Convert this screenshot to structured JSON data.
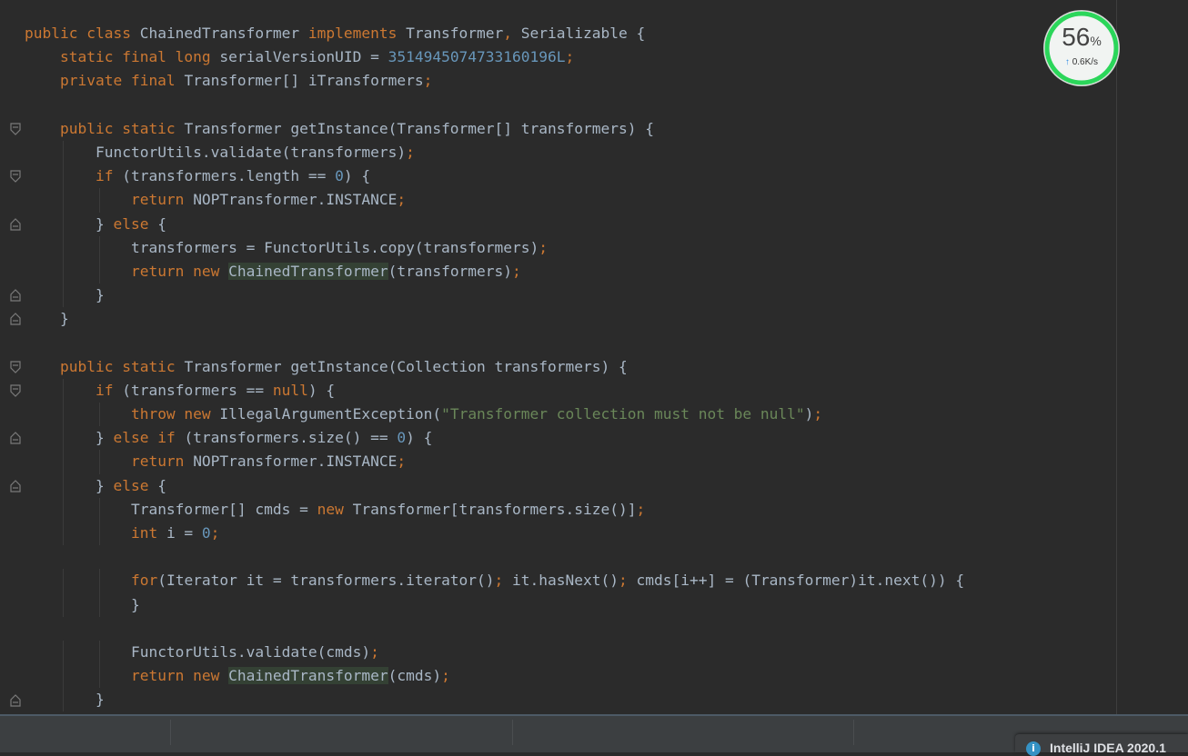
{
  "code_lines": [
    [
      {
        "t": "public class ",
        "c": "kw"
      },
      {
        "t": "ChainedTransformer "
      },
      {
        "t": "implements ",
        "c": "kw"
      },
      {
        "t": "Transformer"
      },
      {
        "t": ", ",
        "c": "kw"
      },
      {
        "t": "Serializable {"
      }
    ],
    [
      {
        "t": "    "
      },
      {
        "t": "static final long ",
        "c": "kw"
      },
      {
        "t": "serialVersionUID = "
      },
      {
        "t": "3514945074733160196L",
        "c": "num"
      },
      {
        "t": ";",
        "c": "kw"
      }
    ],
    [
      {
        "t": "    "
      },
      {
        "t": "private final ",
        "c": "kw"
      },
      {
        "t": "Transformer[] iTransformers"
      },
      {
        "t": ";",
        "c": "kw"
      }
    ],
    [],
    [
      {
        "t": "    "
      },
      {
        "t": "public static ",
        "c": "kw"
      },
      {
        "t": "Transformer getInstance(Transformer[] transformers) {"
      }
    ],
    [
      {
        "t": "        "
      },
      {
        "t": "FunctorUtils.validate(transformers)"
      },
      {
        "t": ";",
        "c": "kw"
      }
    ],
    [
      {
        "t": "        "
      },
      {
        "t": "if ",
        "c": "kw"
      },
      {
        "t": "(transformers.length == "
      },
      {
        "t": "0",
        "c": "num"
      },
      {
        "t": ") {"
      }
    ],
    [
      {
        "t": "            "
      },
      {
        "t": "return ",
        "c": "kw"
      },
      {
        "t": "NOPTransformer.INSTANCE"
      },
      {
        "t": ";",
        "c": "kw"
      }
    ],
    [
      {
        "t": "        "
      },
      {
        "t": "} "
      },
      {
        "t": "else ",
        "c": "kw"
      },
      {
        "t": "{"
      }
    ],
    [
      {
        "t": "            "
      },
      {
        "t": "transformers = FunctorUtils.copy(transformers)"
      },
      {
        "t": ";",
        "c": "kw"
      }
    ],
    [
      {
        "t": "            "
      },
      {
        "t": "return new ",
        "c": "kw"
      },
      {
        "t": "ChainedTransformer",
        "c": "hl"
      },
      {
        "t": "(transformers)"
      },
      {
        "t": ";",
        "c": "kw"
      }
    ],
    [
      {
        "t": "        "
      },
      {
        "t": "}"
      }
    ],
    [
      {
        "t": "    "
      },
      {
        "t": "}"
      }
    ],
    [],
    [
      {
        "t": "    "
      },
      {
        "t": "public static ",
        "c": "kw"
      },
      {
        "t": "Transformer getInstance(Collection transformers) {"
      }
    ],
    [
      {
        "t": "        "
      },
      {
        "t": "if ",
        "c": "kw"
      },
      {
        "t": "(transformers == "
      },
      {
        "t": "null",
        "c": "kw"
      },
      {
        "t": ") {"
      }
    ],
    [
      {
        "t": "            "
      },
      {
        "t": "throw new ",
        "c": "kw"
      },
      {
        "t": "IllegalArgumentException("
      },
      {
        "t": "\"Transformer collection must not be null\"",
        "c": "str"
      },
      {
        "t": ")"
      },
      {
        "t": ";",
        "c": "kw"
      }
    ],
    [
      {
        "t": "        "
      },
      {
        "t": "} "
      },
      {
        "t": "else if ",
        "c": "kw"
      },
      {
        "t": "(transformers.size() == "
      },
      {
        "t": "0",
        "c": "num"
      },
      {
        "t": ") {"
      }
    ],
    [
      {
        "t": "            "
      },
      {
        "t": "return ",
        "c": "kw"
      },
      {
        "t": "NOPTransformer.INSTANCE"
      },
      {
        "t": ";",
        "c": "kw"
      }
    ],
    [
      {
        "t": "        "
      },
      {
        "t": "} "
      },
      {
        "t": "else ",
        "c": "kw"
      },
      {
        "t": "{"
      }
    ],
    [
      {
        "t": "            "
      },
      {
        "t": "Transformer[] cmds = "
      },
      {
        "t": "new ",
        "c": "kw"
      },
      {
        "t": "Transformer[transformers.size()]"
      },
      {
        "t": ";",
        "c": "kw"
      }
    ],
    [
      {
        "t": "            "
      },
      {
        "t": "int ",
        "c": "kw"
      },
      {
        "t": "i = "
      },
      {
        "t": "0",
        "c": "num"
      },
      {
        "t": ";",
        "c": "kw"
      }
    ],
    [],
    [
      {
        "t": "            "
      },
      {
        "t": "for",
        "c": "kw"
      },
      {
        "t": "(Iterator it = transformers.iterator()"
      },
      {
        "t": "; ",
        "c": "kw"
      },
      {
        "t": "it.hasNext()"
      },
      {
        "t": "; ",
        "c": "kw"
      },
      {
        "t": "cmds[i++] = (Transformer)it.next()) {"
      }
    ],
    [
      {
        "t": "            "
      },
      {
        "t": "}"
      }
    ],
    [],
    [
      {
        "t": "            "
      },
      {
        "t": "FunctorUtils.validate(cmds)"
      },
      {
        "t": ";",
        "c": "kw"
      }
    ],
    [
      {
        "t": "            "
      },
      {
        "t": "return new ",
        "c": "kw"
      },
      {
        "t": "ChainedTransformer",
        "c": "hl"
      },
      {
        "t": "(cmds)"
      },
      {
        "t": ";",
        "c": "kw"
      }
    ],
    [
      {
        "t": "        "
      },
      {
        "t": "}"
      }
    ]
  ],
  "fold_markers": [
    {
      "line": 4,
      "type": "open"
    },
    {
      "line": 6,
      "type": "open"
    },
    {
      "line": 8,
      "type": "close"
    },
    {
      "line": 11,
      "type": "close"
    },
    {
      "line": 12,
      "type": "close"
    },
    {
      "line": 14,
      "type": "open"
    },
    {
      "line": 15,
      "type": "open"
    },
    {
      "line": 17,
      "type": "close"
    },
    {
      "line": 19,
      "type": "close"
    },
    {
      "line": 28,
      "type": "close"
    }
  ],
  "widget": {
    "percent": "56",
    "percent_sign": "%",
    "percent_value": 56,
    "speed": "0.6K/s",
    "arrow": "↑"
  },
  "notification": {
    "text": "IntelliJ IDEA 2020.1"
  },
  "colors": {
    "background": "#2b2b2b",
    "keyword": "#cc7832",
    "number": "#6897bb",
    "string": "#6a8759",
    "text": "#a9b7c6",
    "ring": "#2bd65a"
  }
}
